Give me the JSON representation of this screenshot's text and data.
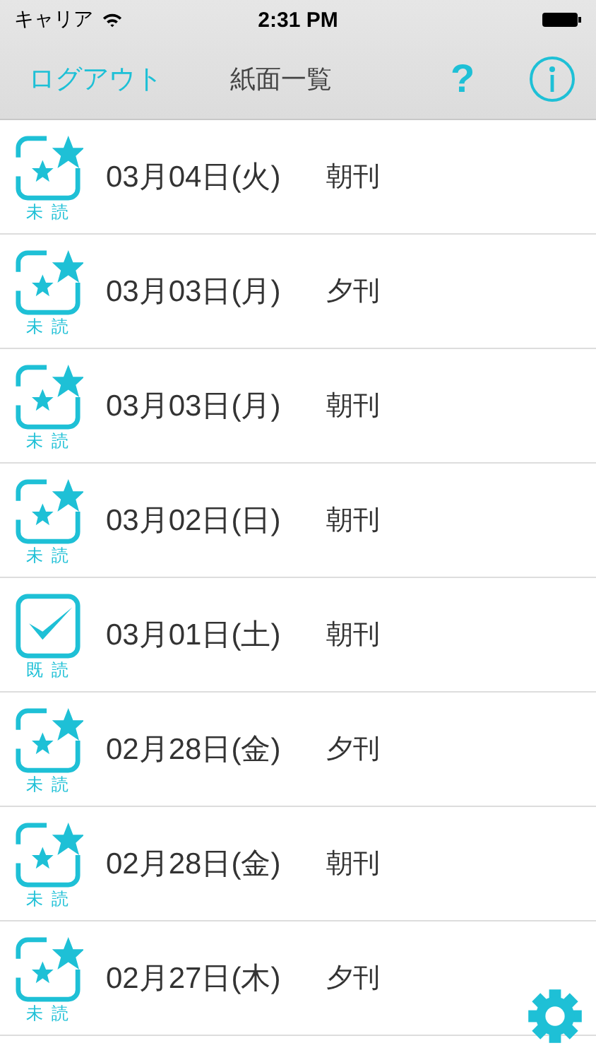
{
  "status_bar": {
    "carrier": "キャリア",
    "time": "2:31 PM"
  },
  "nav": {
    "logout": "ログアウト",
    "title": "紙面一覧",
    "help": "?"
  },
  "issues": [
    {
      "date": "03月04日(火)",
      "edition": "朝刊",
      "read": false,
      "status": "未 読"
    },
    {
      "date": "03月03日(月)",
      "edition": "夕刊",
      "read": false,
      "status": "未 読"
    },
    {
      "date": "03月03日(月)",
      "edition": "朝刊",
      "read": false,
      "status": "未 読"
    },
    {
      "date": "03月02日(日)",
      "edition": "朝刊",
      "read": false,
      "status": "未 読"
    },
    {
      "date": "03月01日(土)",
      "edition": "朝刊",
      "read": true,
      "status": "既 読"
    },
    {
      "date": "02月28日(金)",
      "edition": "夕刊",
      "read": false,
      "status": "未 読"
    },
    {
      "date": "02月28日(金)",
      "edition": "朝刊",
      "read": false,
      "status": "未 読"
    },
    {
      "date": "02月27日(木)",
      "edition": "夕刊",
      "read": false,
      "status": "未 読"
    }
  ]
}
